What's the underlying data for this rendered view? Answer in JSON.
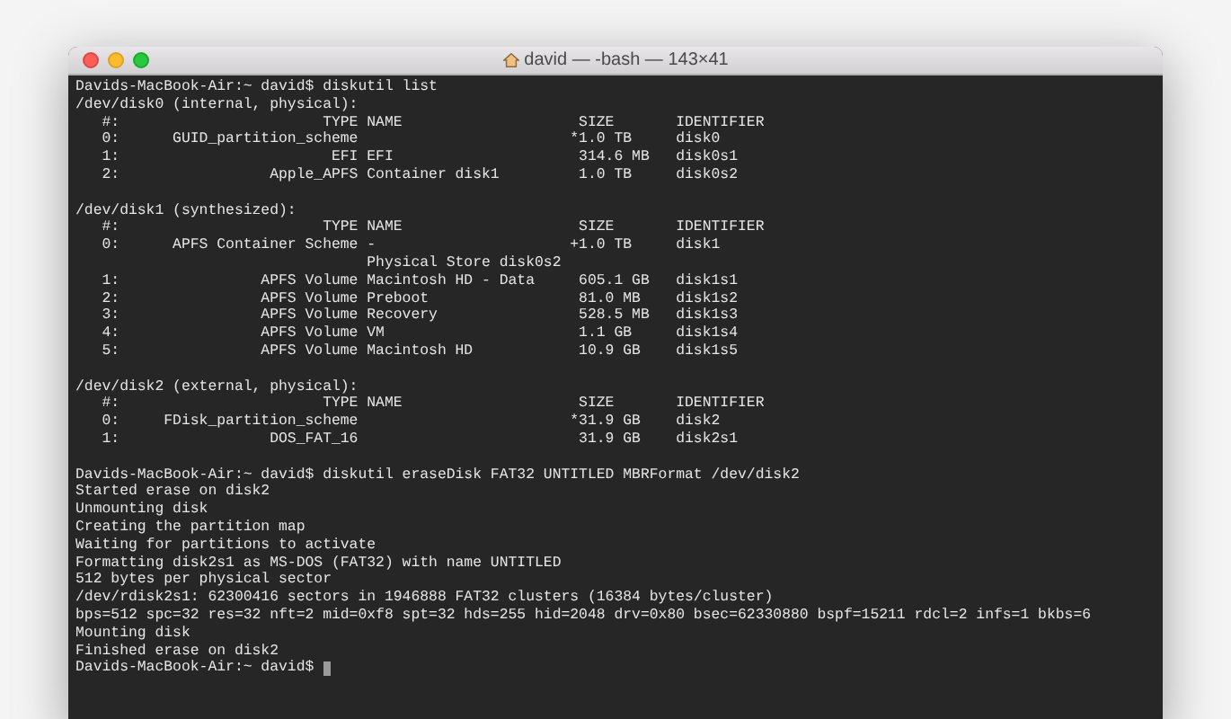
{
  "window": {
    "title": "david — -bash — 143×41"
  },
  "terminal": {
    "blocks": [
      [
        "Davids-MacBook-Air:~ david$ diskutil list",
        "/dev/disk0 (internal, physical):",
        "   #:                       TYPE NAME                    SIZE       IDENTIFIER",
        "   0:      GUID_partition_scheme                        *1.0 TB     disk0",
        "   1:                        EFI EFI                     314.6 MB   disk0s1",
        "   2:                 Apple_APFS Container disk1         1.0 TB     disk0s2"
      ],
      [
        "/dev/disk1 (synthesized):",
        "   #:                       TYPE NAME                    SIZE       IDENTIFIER",
        "   0:      APFS Container Scheme -                      +1.0 TB     disk1",
        "                                 Physical Store disk0s2",
        "   1:                APFS Volume Macintosh HD - Data     605.1 GB   disk1s1",
        "   2:                APFS Volume Preboot                 81.0 MB    disk1s2",
        "   3:                APFS Volume Recovery                528.5 MB   disk1s3",
        "   4:                APFS Volume VM                      1.1 GB     disk1s4",
        "   5:                APFS Volume Macintosh HD            10.9 GB    disk1s5"
      ],
      [
        "/dev/disk2 (external, physical):",
        "   #:                       TYPE NAME                    SIZE       IDENTIFIER",
        "   0:     FDisk_partition_scheme                        *31.9 GB    disk2",
        "   1:                 DOS_FAT_16                         31.9 GB    disk2s1"
      ],
      [
        "Davids-MacBook-Air:~ david$ diskutil eraseDisk FAT32 UNTITLED MBRFormat /dev/disk2",
        "Started erase on disk2",
        "Unmounting disk",
        "Creating the partition map",
        "Waiting for partitions to activate",
        "Formatting disk2s1 as MS-DOS (FAT32) with name UNTITLED",
        "512 bytes per physical sector",
        "/dev/rdisk2s1: 62300416 sectors in 1946888 FAT32 clusters (16384 bytes/cluster)",
        "bps=512 spc=32 res=32 nft=2 mid=0xf8 spt=32 hds=255 hid=2048 drv=0x80 bsec=62330880 bspf=15211 rdcl=2 infs=1 bkbs=6",
        "Mounting disk",
        "Finished erase on disk2"
      ]
    ],
    "prompt": "Davids-MacBook-Air:~ david$"
  }
}
